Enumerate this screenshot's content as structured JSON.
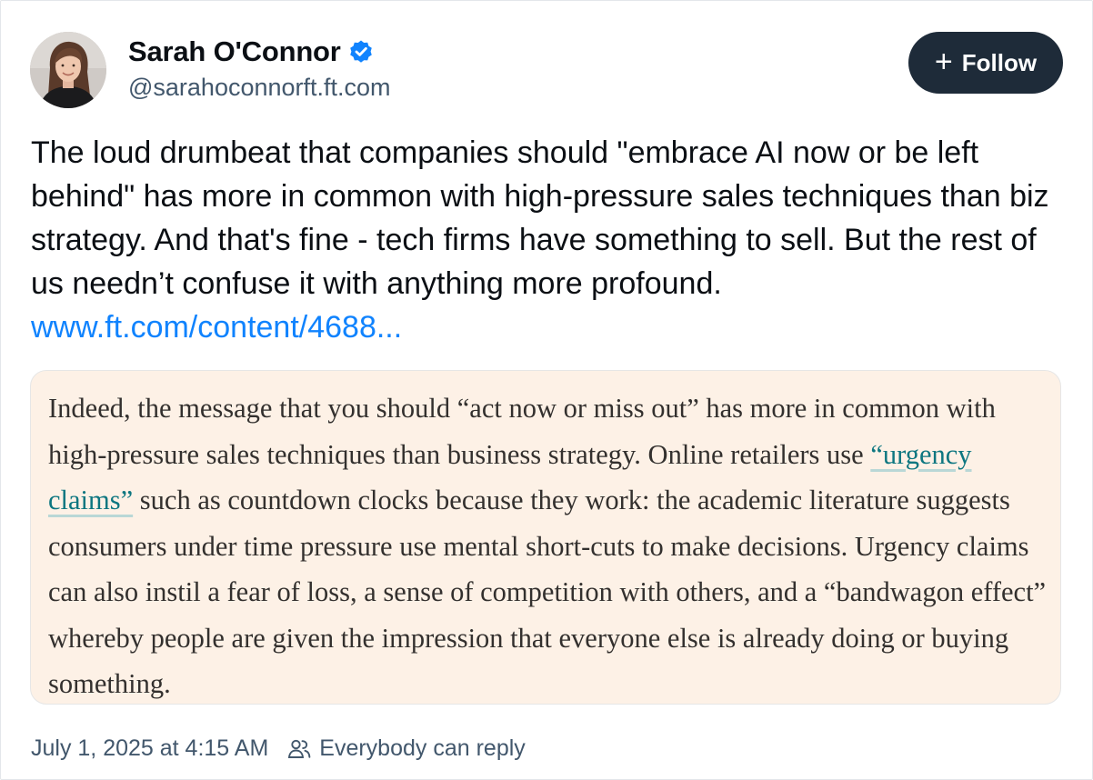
{
  "author": {
    "display_name": "Sarah O'Connor",
    "handle": "@sarahoconnorft.ft.com",
    "verified": true,
    "avatar": "profile-photo"
  },
  "follow_button": {
    "icon": "plus-icon",
    "label": "Follow"
  },
  "post": {
    "text": "The loud drumbeat that companies should \"embrace AI now or be left behind\" has more in common with high-pressure sales techniques than biz strategy. And that's fine - tech firms have something to sell. But the rest of us needn’t confuse it with anything more profound. ",
    "link_text": "www.ft.com/content/4688..."
  },
  "quote": {
    "text_before": "Indeed, the message that you should “act now or miss out” has more in common with high-pressure sales techniques than business strategy. Online retailers use ",
    "link_text": "“urgency claims”",
    "text_after": " such as countdown clocks because they work: the academic literature suggests consumers under time pressure use mental short-cuts to make decisions. Urgency claims can also instil a fear of loss, a sense of competition with others, and a “bandwagon effect” whereby people are given the impression that everyone else is already doing or buying something."
  },
  "footer": {
    "timestamp": "July 1, 2025 at 4:15 AM",
    "reply_icon": "people-icon",
    "reply_setting": "Everybody can reply"
  },
  "colors": {
    "verified_badge": "#1083fe",
    "follow_button_bg": "#1e2b39",
    "link": "#1083fe",
    "quote_bg": "#fdf1e6",
    "quote_link": "#0d7680",
    "secondary_text": "#42576c"
  }
}
